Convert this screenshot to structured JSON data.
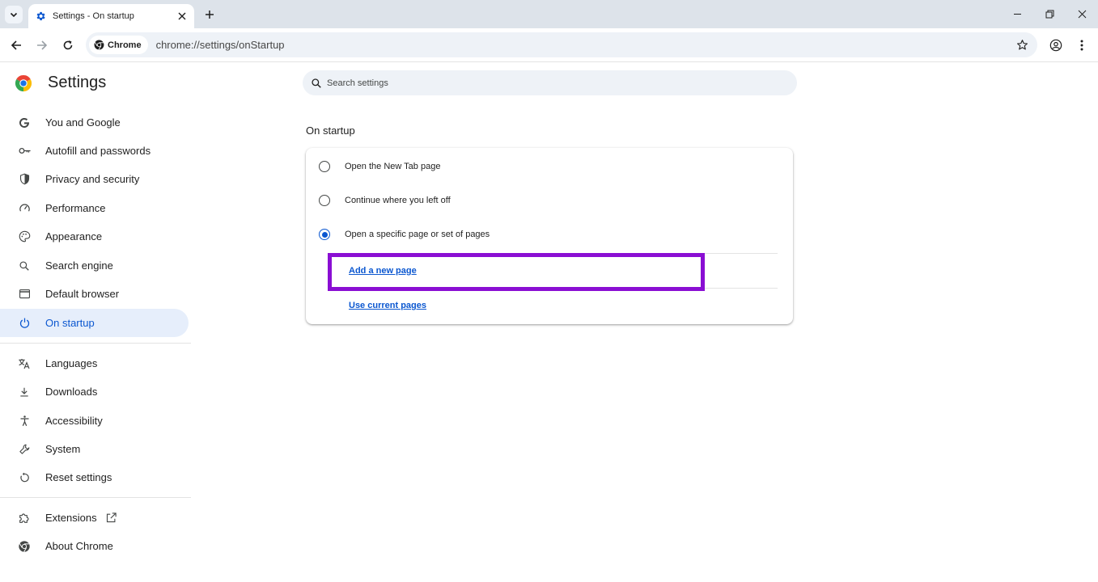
{
  "tab": {
    "title": "Settings - On startup"
  },
  "omnibox": {
    "chip_label": "Chrome",
    "url": "chrome://settings/onStartup"
  },
  "sidebar": {
    "title": "Settings",
    "items": [
      {
        "label": "You and Google",
        "icon": "google-g-icon"
      },
      {
        "label": "Autofill and passwords",
        "icon": "key-icon"
      },
      {
        "label": "Privacy and security",
        "icon": "shield-icon"
      },
      {
        "label": "Performance",
        "icon": "speedometer-icon"
      },
      {
        "label": "Appearance",
        "icon": "palette-icon"
      },
      {
        "label": "Search engine",
        "icon": "search-icon"
      },
      {
        "label": "Default browser",
        "icon": "browser-window-icon"
      },
      {
        "label": "On startup",
        "icon": "power-icon",
        "active": true
      },
      {
        "label": "Languages",
        "icon": "translate-icon"
      },
      {
        "label": "Downloads",
        "icon": "download-icon"
      },
      {
        "label": "Accessibility",
        "icon": "accessibility-icon"
      },
      {
        "label": "System",
        "icon": "wrench-icon"
      },
      {
        "label": "Reset settings",
        "icon": "reset-icon"
      },
      {
        "label": "Extensions",
        "icon": "puzzle-icon"
      },
      {
        "label": "About Chrome",
        "icon": "chrome-icon"
      }
    ]
  },
  "search": {
    "placeholder": "Search settings"
  },
  "startup": {
    "section_title": "On startup",
    "options": [
      {
        "label": "Open the New Tab page",
        "checked": false
      },
      {
        "label": "Continue where you left off",
        "checked": false
      },
      {
        "label": "Open a specific page or set of pages",
        "checked": true
      }
    ],
    "add_page_link": "Add a new page",
    "use_current_link": "Use current pages"
  },
  "colors": {
    "accent": "#0b57d0",
    "highlight": "#8a0ed3",
    "active_nav_bg": "#e6eefb",
    "tabstrip_bg": "#dde3ea"
  }
}
